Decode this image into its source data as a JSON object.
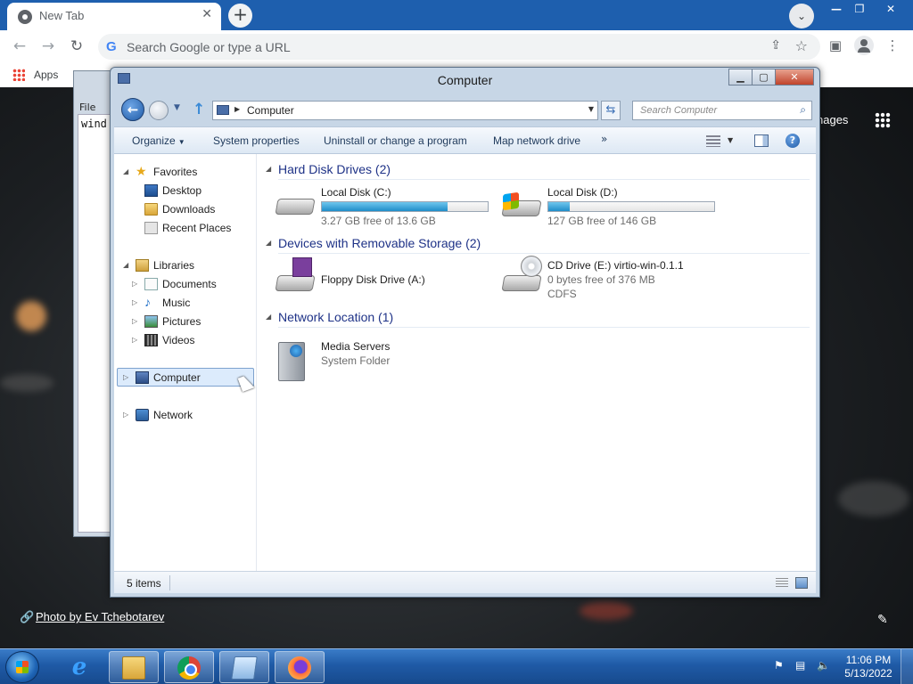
{
  "browser": {
    "tab_title": "New Tab",
    "omnibox_placeholder": "Search Google or type a URL",
    "bookmarks": {
      "apps_label": "Apps"
    },
    "ntp": {
      "images_link": "nages",
      "photo_credit": "Photo by Ev Tchebotarev"
    }
  },
  "notepad": {
    "menu_file": "File",
    "text": "wind"
  },
  "explorer": {
    "title": "Computer",
    "address": "Computer",
    "search_placeholder": "Search Computer",
    "commands": {
      "organize": "Organize",
      "system_properties": "System properties",
      "uninstall": "Uninstall or change a program",
      "map_drive": "Map network drive",
      "more": "»"
    },
    "nav": {
      "favorites": "Favorites",
      "desktop": "Desktop",
      "downloads": "Downloads",
      "recent_places": "Recent Places",
      "libraries": "Libraries",
      "documents": "Documents",
      "music": "Music",
      "pictures": "Pictures",
      "videos": "Videos",
      "computer": "Computer",
      "network": "Network"
    },
    "groups": {
      "hdd": "Hard Disk Drives (2)",
      "removable": "Devices with Removable Storage (2)",
      "network": "Network Location (1)"
    },
    "drives": {
      "c": {
        "name": "Local Disk (C:)",
        "free": "3.27 GB free of 13.6 GB",
        "used_fraction": 0.76
      },
      "d": {
        "name": "Local Disk (D:)",
        "free": "127 GB free of 146 GB",
        "used_fraction": 0.13
      },
      "a": {
        "name": "Floppy Disk Drive (A:)"
      },
      "e": {
        "name": "CD Drive (E:) virtio-win-0.1.1",
        "free": "0 bytes free of 376 MB",
        "fs": "CDFS"
      },
      "media": {
        "name": "Media Servers",
        "type": "System Folder"
      }
    },
    "status": "5 items"
  },
  "taskbar": {
    "time": "11:06 PM",
    "date": "5/13/2022"
  },
  "colors": {
    "chrome_tabbar": "#1e5fae",
    "group_header": "#1e3287",
    "drive_bar_fill": "#1f8dc8",
    "taskbar": "#1f5aa6"
  }
}
